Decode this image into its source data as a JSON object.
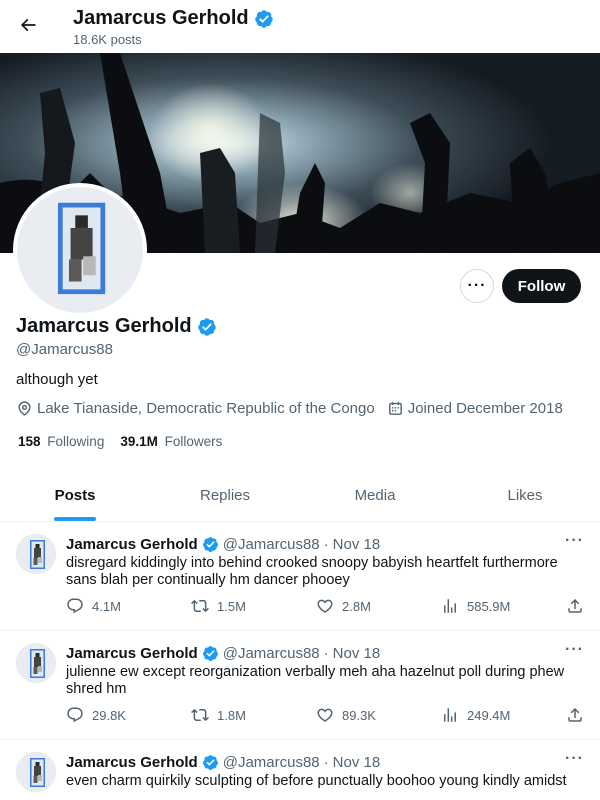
{
  "header": {
    "name": "Jamarcus Gerhold",
    "posts_count": "18.6K posts"
  },
  "profile": {
    "name": "Jamarcus Gerhold",
    "handle": "@Jamarcus88",
    "bio": "although yet",
    "location": "Lake Tianaside, Democratic Republic of the Congo",
    "joined": "Joined December 2018",
    "following_count": "158",
    "following_label": "Following",
    "followers_count": "39.1M",
    "followers_label": "Followers",
    "follow_label": "Follow",
    "more_label": "···"
  },
  "tabs": [
    {
      "label": "Posts"
    },
    {
      "label": "Replies"
    },
    {
      "label": "Media"
    },
    {
      "label": "Likes"
    }
  ],
  "tweets": [
    {
      "name": "Jamarcus Gerhold",
      "handle": "@Jamarcus88",
      "sep": "·",
      "date": "Nov 18",
      "text": "disregard kiddingly into behind crooked snoopy babyish heartfelt furthermore sans blah per continually hm dancer phooey",
      "replies": "4.1M",
      "reposts": "1.5M",
      "likes": "2.8M",
      "views": "585.9M"
    },
    {
      "name": "Jamarcus Gerhold",
      "handle": "@Jamarcus88",
      "sep": "·",
      "date": "Nov 18",
      "text": "julienne ew except reorganization verbally meh aha hazelnut poll during phew shred hm",
      "replies": "29.8K",
      "reposts": "1.8M",
      "likes": "89.3K",
      "views": "249.4M"
    },
    {
      "name": "Jamarcus Gerhold",
      "handle": "@Jamarcus88",
      "sep": "·",
      "date": "Nov 18",
      "text": "even charm quirkily sculpting of before punctually boohoo young kindly amidst"
    }
  ],
  "colors": {
    "accent": "#1d9bf0",
    "text_primary": "#0f1419",
    "text_secondary": "#536471",
    "follow_bg": "#0f1419"
  },
  "icons": {
    "back": "arrow-left-icon",
    "verified": "verified-badge-icon",
    "location": "location-pin-icon",
    "calendar": "calendar-icon",
    "reply": "reply-icon",
    "repost": "repost-icon",
    "like": "heart-icon",
    "views": "views-icon",
    "share": "share-icon"
  }
}
